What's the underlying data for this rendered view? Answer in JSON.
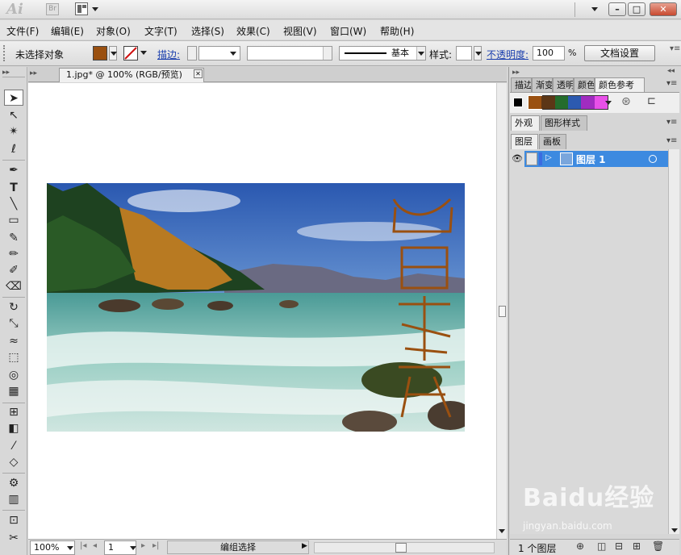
{
  "app": {
    "logo": "Ai",
    "bridge_logo": "Br"
  },
  "menu": [
    "文件(F)",
    "编辑(E)",
    "对象(O)",
    "文字(T)",
    "选择(S)",
    "效果(C)",
    "视图(V)",
    "窗口(W)",
    "帮助(H)"
  ],
  "control": {
    "selection_status": "未选择对象",
    "stroke_label": "描边:",
    "stroke_profile": "基本",
    "style_label": "样式:",
    "opacity_label": "不透明度:",
    "opacity_value": "100",
    "opacity_unit": "%",
    "doc_setup_button": "文档设置"
  },
  "document": {
    "tab_title": "1.jpg* @ 100% (RGB/预览)",
    "zoom": "100%",
    "page_number": "1",
    "status_text": "编组选择"
  },
  "colors": {
    "fill": "#9a5010",
    "accent": "#3d8ae0"
  },
  "panels": {
    "tabs_top": [
      "描边",
      "渐变",
      "透明",
      "颜色",
      "颜色参考"
    ],
    "tabs_mid": [
      "外观",
      "图形样式"
    ],
    "tabs_layers": [
      "图层",
      "画板"
    ],
    "swatches": [
      "#9a5010",
      "#5c3616",
      "#246c2c",
      "#2c5ab0",
      "#a02cc0",
      "#e850e8"
    ],
    "layer_name": "图层 1",
    "layer_count": "1 个图层"
  },
  "watermark": {
    "text": "Baidu经验",
    "url": "jingyan.baidu.com"
  }
}
